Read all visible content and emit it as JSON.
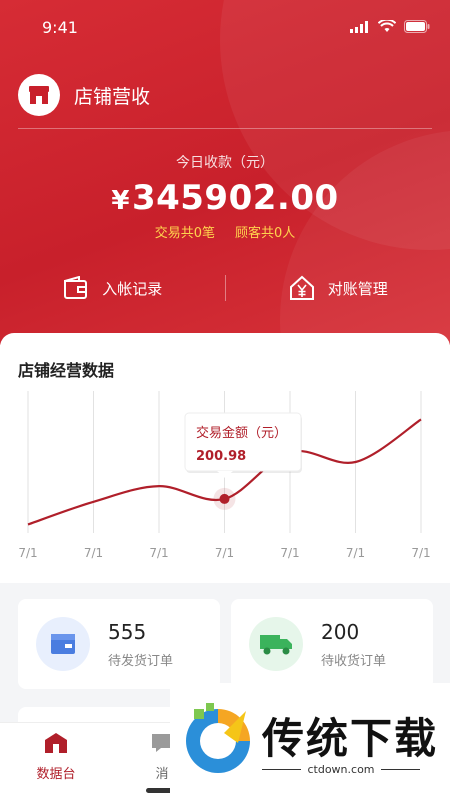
{
  "status_bar": {
    "time": "9:41"
  },
  "store": {
    "title": "店铺营收"
  },
  "summary": {
    "label": "今日收款（元）",
    "currency": "¥",
    "amount": "345902.00",
    "transactions": "交易共0笔",
    "customers": "顾客共0人"
  },
  "actions": {
    "income_records": "入帐记录",
    "reconciliation": "对账管理"
  },
  "chart": {
    "title": "店铺经营数据",
    "tooltip_label": "交易金额（元）",
    "tooltip_value": "200.98"
  },
  "chart_data": {
    "type": "line",
    "categories": [
      "7/1",
      "7/1",
      "7/1",
      "7/1",
      "7/1",
      "7/1",
      "7/1"
    ],
    "series": [
      {
        "values": [
          30,
          110,
          165,
          120,
          285,
          250,
          400
        ]
      }
    ],
    "highlight_index": 3,
    "ylim": [
      0,
      500
    ],
    "grid": "vertical",
    "legend": "none",
    "colors": {
      "line": "#b01f2a"
    }
  },
  "stats": [
    {
      "value": "555",
      "label": "待发货订单",
      "icon": "box-icon",
      "color": "#4a7de0"
    },
    {
      "value": "200",
      "label": "待收货订单",
      "icon": "truck-icon",
      "color": "#3bb35c"
    }
  ],
  "tabs": [
    {
      "label": "数据台",
      "icon": "store-icon",
      "active": true
    },
    {
      "label": "消",
      "icon": "message-icon",
      "active": false
    }
  ],
  "watermark": {
    "name": "传统下载",
    "url": "ctdown.com"
  },
  "colors": {
    "brand": "#c8202b",
    "accent": "#ffd34e"
  }
}
